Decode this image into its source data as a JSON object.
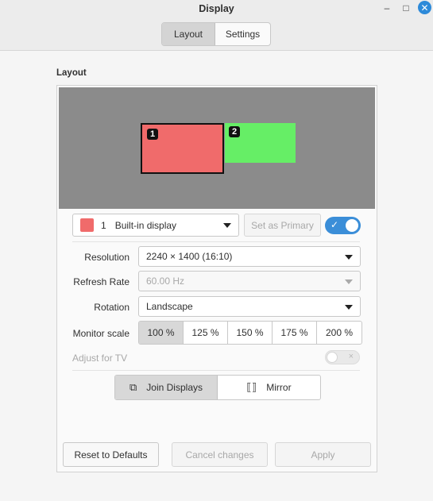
{
  "window": {
    "title": "Display",
    "minimize_glyph": "–",
    "maximize_glyph": "□",
    "close_glyph": "✕"
  },
  "tabs": [
    {
      "label": "Layout",
      "active": true
    },
    {
      "label": "Settings",
      "active": false
    }
  ],
  "section_title": "Layout",
  "preview": {
    "monitors": [
      {
        "number": "1",
        "color": "#f06b6b",
        "selected": true
      },
      {
        "number": "2",
        "color": "#66ee66",
        "selected": false
      }
    ]
  },
  "display_select": {
    "color": "#f06b6b",
    "number": "1",
    "name": "Built-in display"
  },
  "set_primary_label": "Set as Primary",
  "enabled_toggle": {
    "on": true,
    "glyph": "✓"
  },
  "resolution": {
    "label": "Resolution",
    "value": "2240 × 1400 (16:10)"
  },
  "refresh_rate": {
    "label": "Refresh Rate",
    "value": "60.00 Hz",
    "disabled": true
  },
  "rotation": {
    "label": "Rotation",
    "value": "Landscape"
  },
  "monitor_scale": {
    "label": "Monitor scale",
    "options": [
      "100 %",
      "125 %",
      "150 %",
      "175 %",
      "200 %"
    ],
    "selected": "100 %"
  },
  "adjust_tv": {
    "label": "Adjust for TV",
    "on": false,
    "glyph": "×",
    "disabled": true
  },
  "mode": {
    "join_label": "Join Displays",
    "mirror_label": "Mirror",
    "join_icon": "⧉",
    "mirror_icon": "⟦⟧",
    "selected": "join"
  },
  "footer": {
    "reset_label": "Reset to Defaults",
    "cancel_label": "Cancel changes",
    "apply_label": "Apply"
  },
  "colors": {
    "accent": "#3b8ed8",
    "close": "#2d8ad9"
  }
}
